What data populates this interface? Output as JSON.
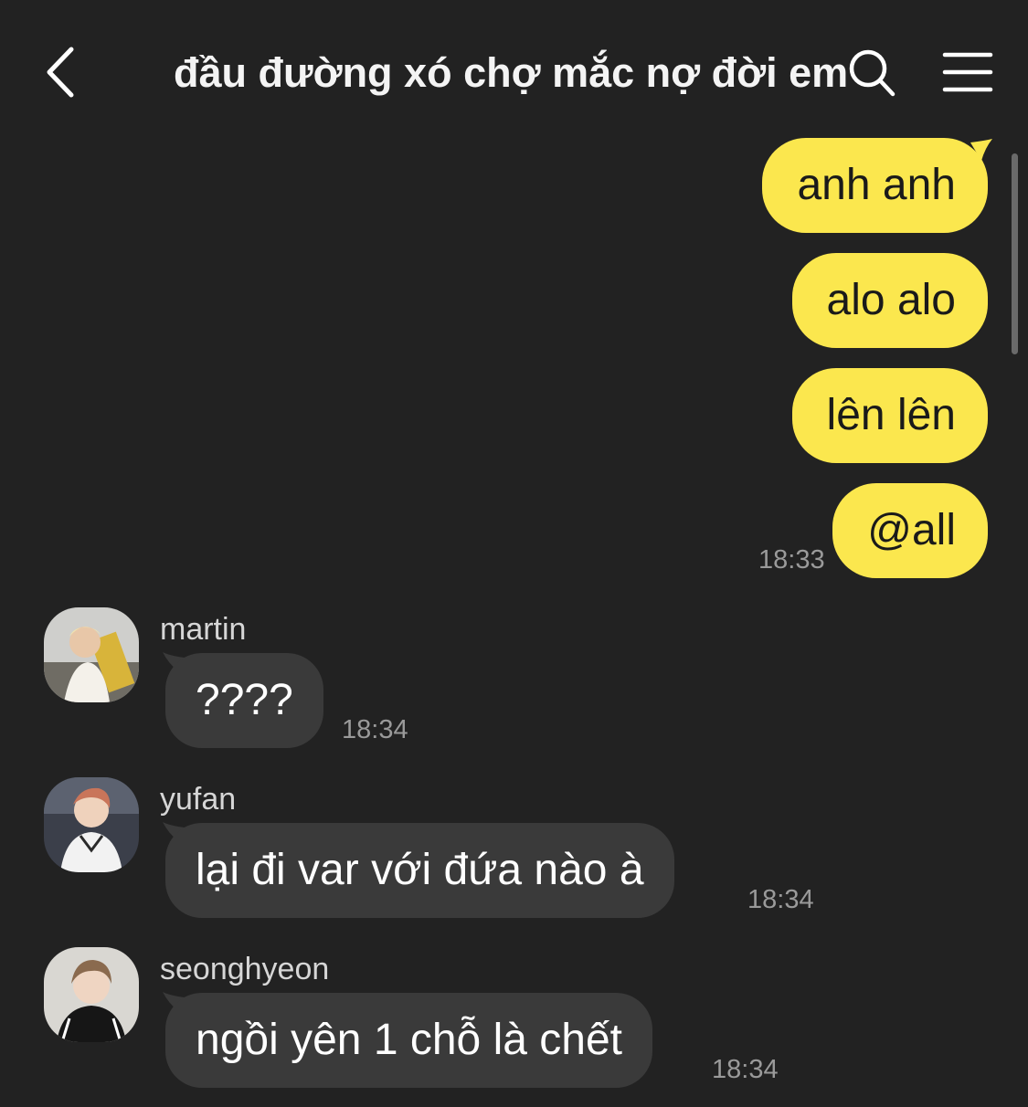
{
  "header": {
    "title": "đầu đường xó chợ mắc nợ đời em",
    "back_icon": "chevron-left-icon",
    "search_icon": "search-icon",
    "menu_icon": "hamburger-menu-icon"
  },
  "colors": {
    "background": "#222222",
    "outgoing_bubble": "#fbe74e",
    "incoming_bubble": "#3a3a3a",
    "timestamp": "#9a9a9a"
  },
  "outgoing": {
    "messages": [
      "anh anh",
      "alo alo",
      "lên lên",
      "@all"
    ],
    "time": "18:33"
  },
  "incoming": [
    {
      "sender": "martin",
      "text": "????",
      "time": "18:34"
    },
    {
      "sender": "yufan",
      "text": "lại đi var với đứa nào à",
      "time": "18:34"
    },
    {
      "sender": "seonghyeon",
      "text": "ngồi yên 1 chỗ là chết",
      "time": "18:34"
    }
  ]
}
